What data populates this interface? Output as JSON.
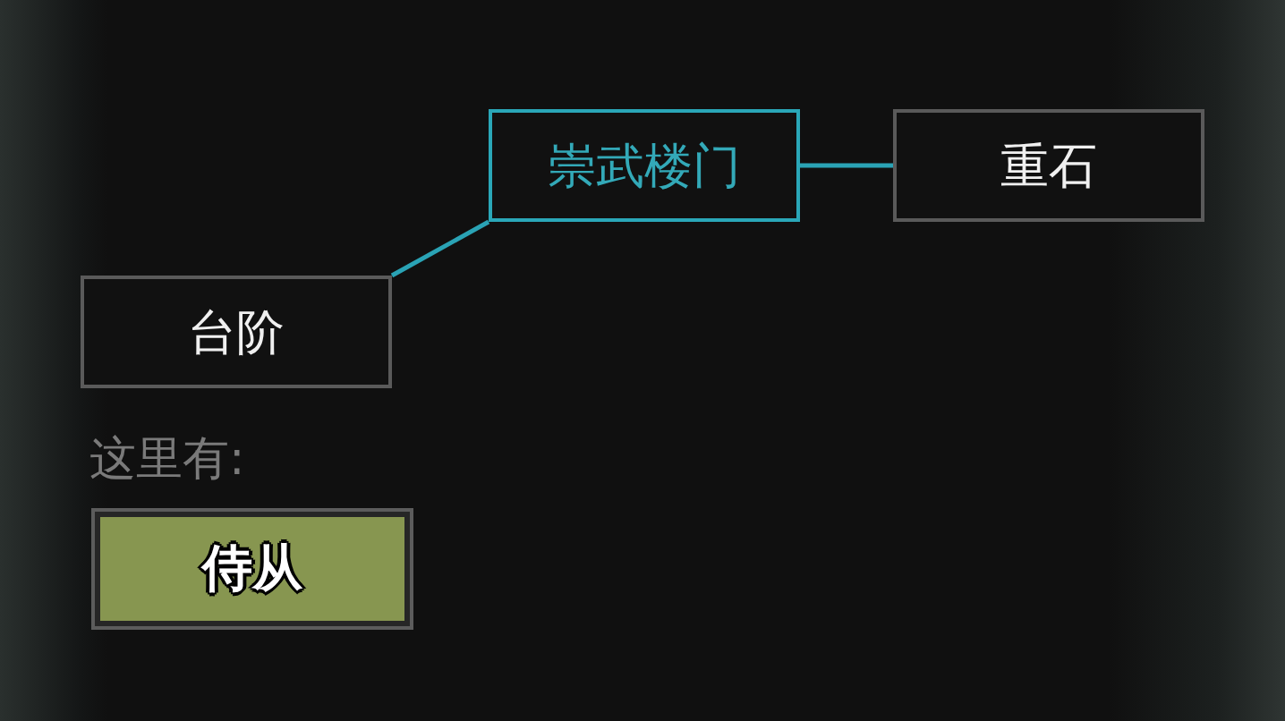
{
  "map": {
    "root": {
      "label": "崇武楼门",
      "selected": true,
      "children": [
        {
          "label": "重石",
          "selected": false
        },
        {
          "label": "台阶",
          "selected": false
        }
      ]
    }
  },
  "here": {
    "label": "这里有:",
    "items": [
      {
        "label": "侍从"
      }
    ]
  }
}
